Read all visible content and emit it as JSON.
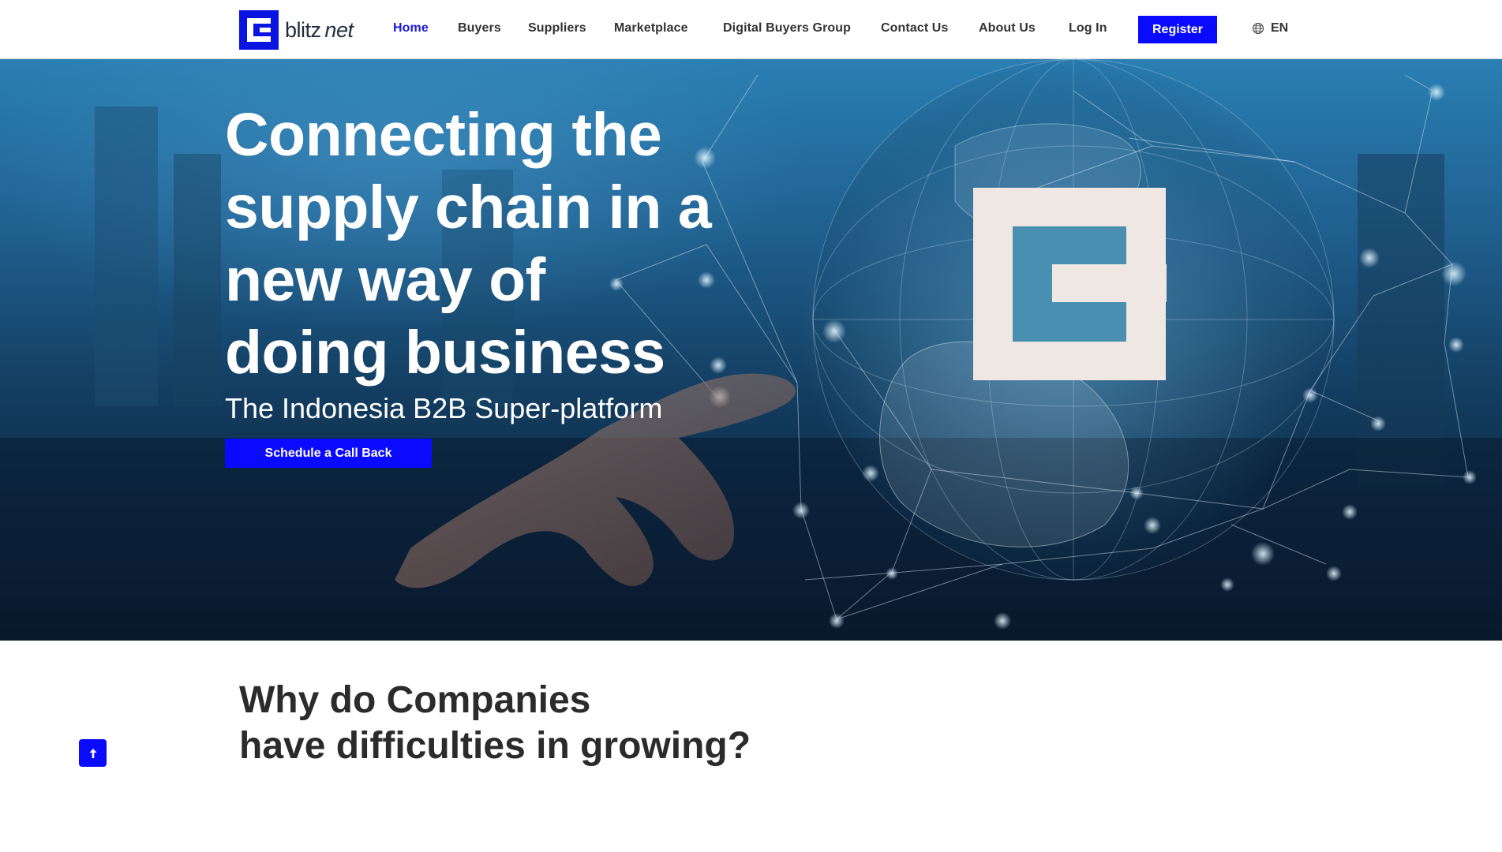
{
  "brand": {
    "name_part1": "blitz",
    "name_part2": "net"
  },
  "nav": {
    "items": [
      {
        "label": "Home",
        "active": true
      },
      {
        "label": "Buyers"
      },
      {
        "label": "Suppliers"
      },
      {
        "label": "Marketplace"
      },
      {
        "label": "Digital Buyers Group"
      },
      {
        "label": "Contact Us"
      },
      {
        "label": "About Us"
      },
      {
        "label": "Log In"
      }
    ],
    "register_label": "Register",
    "language": "EN"
  },
  "hero": {
    "title_lines": [
      "Connecting the",
      "supply chain in a",
      "new way of",
      "doing business"
    ],
    "subtitle": "The Indonesia B2B Super-platform",
    "cta_label": "Schedule a Call Back"
  },
  "section": {
    "title_line1": "Why do Companies",
    "title_line2": "have difficulties in growing?"
  },
  "scroll_top_icon": "arrow-up-icon",
  "colors": {
    "accent": "#0a0aff",
    "nav_active": "#1a1ad6"
  }
}
